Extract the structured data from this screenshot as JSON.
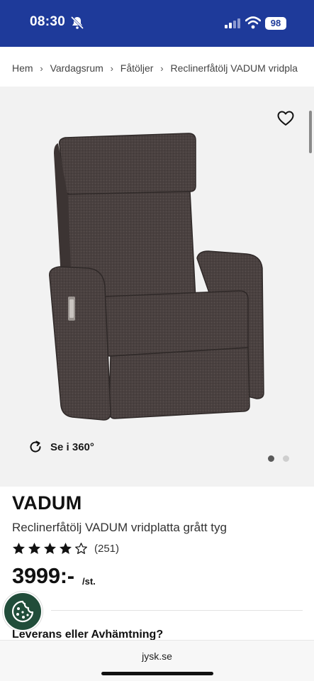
{
  "status_bar": {
    "time": "08:30",
    "battery": "98",
    "background": "#1e3a9a"
  },
  "breadcrumb": {
    "items": [
      "Hem",
      "Vardagsrum",
      "Fåtöljer",
      "Reclinerfåtölj VADUM vridpla"
    ],
    "separator": "›"
  },
  "gallery": {
    "view_360_label": "Se i 360°",
    "image_count": 2,
    "active_index": 1,
    "icons": [
      "heart-icon",
      "rotate-icon"
    ]
  },
  "product": {
    "name": "VADUM",
    "description": "Reclinerfåtölj VADUM vridplatta grått tyg",
    "rating": 4,
    "rating_max": 5,
    "review_count": "(251)",
    "price": "3999:-",
    "price_unit": "/st."
  },
  "delivery": {
    "heading": "Leverans eller Avhämtning?"
  },
  "browser": {
    "url": "jysk.se"
  },
  "cookie_button": {
    "icon": "cookie-icon",
    "color": "#214d3a"
  }
}
